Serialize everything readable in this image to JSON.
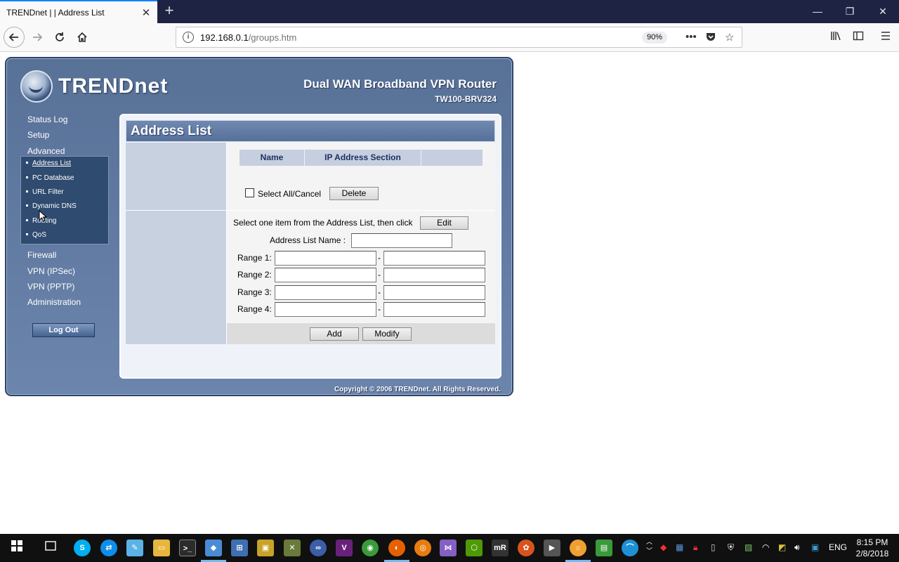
{
  "browser": {
    "tab_title": "TRENDnet | | Address List",
    "tab_close": "✕",
    "new_tab": "+",
    "url_host": "192.168.0.1",
    "url_path": "/groups.htm",
    "zoom": "90%",
    "window_controls": {
      "minimize": "—",
      "maximize": "❐",
      "close": "✕"
    }
  },
  "router": {
    "brand": "TRENDnet",
    "product_name": "Dual WAN Broadband VPN Router",
    "model": "TW100-BRV324",
    "menu": [
      "Status Log",
      "Setup",
      "Advanced",
      "Firewall",
      "VPN (IPSec)",
      "VPN (PPTP)",
      "Administration"
    ],
    "advanced_submenu": [
      "Address List",
      "PC Database",
      "URL Filter",
      "Dynamic DNS",
      "Routing",
      "QoS"
    ],
    "active_submenu": "Address List",
    "logout_label": "Log Out",
    "copyright": "Copyright © 2006 TRENDnet. All Rights Reserved."
  },
  "page": {
    "title": "Address List",
    "table_headers": [
      "Name",
      "IP Address Section",
      ""
    ],
    "select_all_label": "Select All/Cancel",
    "delete_label": "Delete",
    "edit_prompt": "Select one item from the Address List, then click",
    "edit_label": "Edit",
    "name_label": "Address List Name :",
    "name_value": "",
    "ranges": [
      {
        "label": "Range 1:",
        "start": "",
        "end": ""
      },
      {
        "label": "Range 2:",
        "start": "",
        "end": ""
      },
      {
        "label": "Range 3:",
        "start": "",
        "end": ""
      },
      {
        "label": "Range 4:",
        "start": "",
        "end": ""
      }
    ],
    "range_separator": "-",
    "add_label": "Add",
    "modify_label": "Modify"
  },
  "taskbar": {
    "language": "ENG",
    "time": "8:15 PM",
    "date": "2/8/2018"
  },
  "colors": {
    "router_frame": "#587196",
    "panel_header": "#56709a",
    "taskbar": "#101010",
    "tab_accent": "#0a84ff"
  }
}
